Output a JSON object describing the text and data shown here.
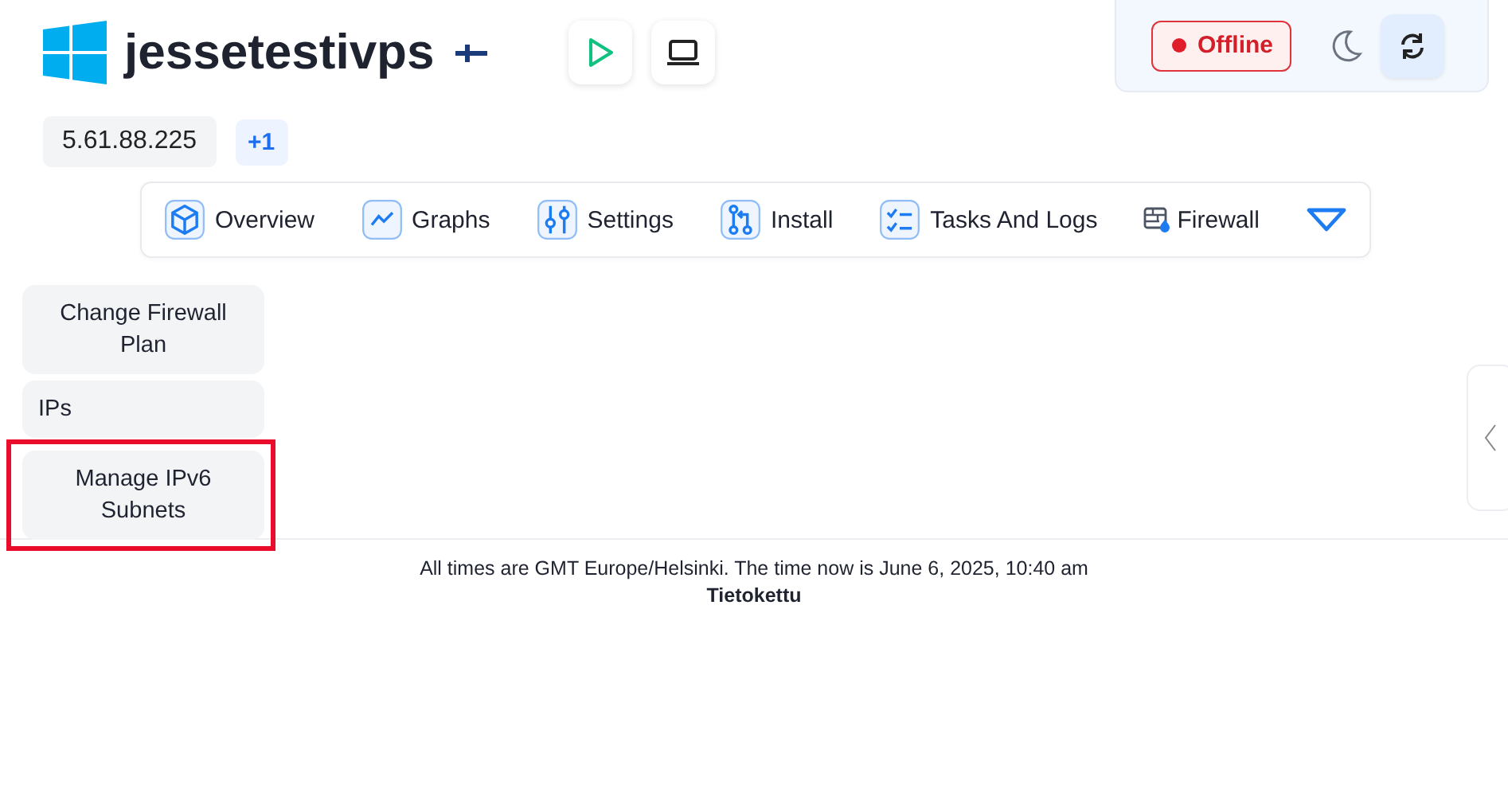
{
  "server": {
    "name": "jessetestivps",
    "ip": "5.61.88.225",
    "extra_ips": "+1"
  },
  "status": {
    "label": "Offline",
    "online": false
  },
  "nav_tabs": [
    {
      "label": "Overview",
      "kind": "cube"
    },
    {
      "label": "Graphs",
      "kind": "graph"
    },
    {
      "label": "Settings",
      "kind": "sliders"
    },
    {
      "label": "Install",
      "kind": "install"
    },
    {
      "label": "Tasks And Logs",
      "kind": "tasks"
    },
    {
      "label": "Firewall",
      "kind": "firewall"
    }
  ],
  "side_menu": [
    {
      "label": "Change Firewall Plan",
      "highlighted": false
    },
    {
      "label": "IPs",
      "highlighted": false
    },
    {
      "label": "Manage IPv6 Subnets",
      "highlighted": true
    }
  ],
  "footer": {
    "note": "All times are GMT Europe/Helsinki. The time now is June 6, 2025, 10:40 am",
    "brand": "Tietokettu"
  }
}
